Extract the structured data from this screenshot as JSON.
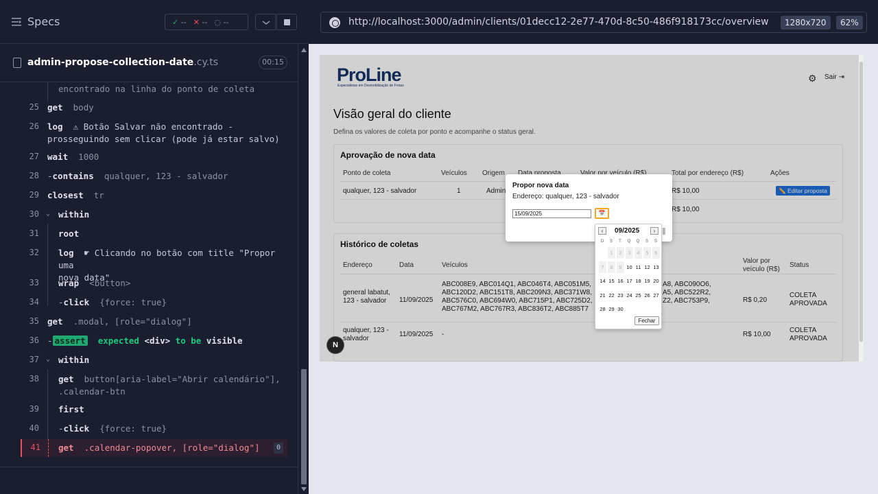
{
  "runner": {
    "title": "Specs",
    "stats": {
      "passed": "--",
      "failed": "--",
      "pending": "--"
    },
    "spec_name": "admin-propose-collection-date",
    "spec_ext": ".cy.ts",
    "duration": "00:15",
    "icons": {
      "specs": "specs-list-icon",
      "file": "document-icon",
      "chevron": "chevron-down-icon",
      "stop": "stop-icon"
    },
    "commands": [
      {
        "num": "",
        "name": "",
        "arg": "encontrado na linha do ponto de coleta"
      },
      {
        "num": "25",
        "name": "get",
        "arg": "body"
      },
      {
        "num": "26",
        "name": "log",
        "arg": "⚠ Botão Salvar não encontrado -",
        "arg2": "prosseguindo sem clicar (pode já estar salvo)"
      },
      {
        "num": "27",
        "name": "wait",
        "arg": "1000"
      },
      {
        "num": "28",
        "name": "contains",
        "arg": "qualquer, 123 - salvador"
      },
      {
        "num": "29",
        "name": "closest",
        "arg": "tr"
      },
      {
        "num": "30",
        "name": "within",
        "arg": ""
      },
      {
        "num": "31",
        "name": "root",
        "arg": ""
      },
      {
        "num": "32",
        "name": "log",
        "arg": "☛ Clicando no botão com title \"Propor uma",
        "arg2": "nova data\""
      },
      {
        "num": "33",
        "name": "wrap",
        "arg": "<button>"
      },
      {
        "num": "34",
        "name": "click",
        "arg": "{force: true}"
      },
      {
        "num": "35",
        "name": "get",
        "arg": ".modal, [role=\"dialog\"]"
      },
      {
        "num": "36",
        "name": "assert",
        "arg": "expected <div> to be visible",
        "a1": "expected",
        "a2": "<div>",
        "a3": "to be",
        "a4": "visible"
      },
      {
        "num": "37",
        "name": "within",
        "arg": ""
      },
      {
        "num": "38",
        "name": "get",
        "arg": "button[aria-label=\"Abrir calendário\"],",
        "arg2": ".calendar-btn"
      },
      {
        "num": "39",
        "name": "first",
        "arg": ""
      },
      {
        "num": "40",
        "name": "click",
        "arg": "{force: true}"
      },
      {
        "num": "41",
        "name": "get",
        "arg": ".calendar-popover, [role=\"dialog\"]",
        "count": "0"
      }
    ]
  },
  "browser": {
    "url": "http://localhost:3000/admin/clients/01decc12-2e77-470d-8c50-486f918173cc/overview",
    "viewport": "1280x720",
    "zoom": "62%"
  },
  "app": {
    "logo": "ProLine",
    "logo_tagline": "Especialistas em Desmobilização de Frotas",
    "logout": "Sair",
    "page_title": "Visão geral do cliente",
    "page_subtitle": "Defina os valores de coleta por ponto e acompanhe o status geral.",
    "approval": {
      "title": "Aprovação de nova data",
      "headers": [
        "Ponto de coleta",
        "Veículos",
        "Origem",
        "Data proposta",
        "Valor por veículo (R$)",
        "Total por endereço (R$)",
        "Ações"
      ],
      "row": {
        "ponto": "qualquer, 123 - salvador",
        "veiculos": "1",
        "origem": "Admin",
        "total": "R$ 10,00",
        "action": "✏️ Editar proposta"
      },
      "footer_total": "R$ 10,00"
    },
    "history": {
      "title": "Histórico de coletas",
      "headers": [
        "Endereço",
        "Data",
        "Veículos",
        "Valor por veículo (R$)",
        "Status"
      ],
      "rows": [
        {
          "endereco": "general labatut, 123 - salvador",
          "data": "11/09/2025",
          "veiculos": "ABC008E9, ABC014Q1, ABC046T4, ABC051M5, ABC120D2, ABC151T8, ABC209N3, ABC371W8, ABC576C0, ABC694W0, ABC715P1, ABC725D2, ABC767M2, ABC767R3, ABC836T2, ABC885T7",
          "veiculos_right1": "A8, ABC090O6,",
          "veiculos_right2": "A5, ABC522R2,",
          "veiculos_right3": "Z2, ABC753P9,",
          "valor": "R$ 0,20",
          "status": "COLETA APROVADA"
        },
        {
          "endereco": "qualquer, 123 - salvador",
          "data": "11/09/2025",
          "veiculos": "-",
          "valor": "R$ 10,00",
          "status": "COLETA APROVADA"
        }
      ]
    },
    "modal": {
      "title": "Propor nova data",
      "address": "Endereço: qualquer, 123 - salvador",
      "date_value": "15/09/2025"
    },
    "calendar": {
      "month": "09/2025",
      "weekdays": [
        "D",
        "S",
        "T",
        "Q",
        "Q",
        "S",
        "S"
      ],
      "weeks": [
        [
          {
            "d": "",
            "dis": true
          },
          {
            "d": "1",
            "dis": true
          },
          {
            "d": "2",
            "dis": true
          },
          {
            "d": "3",
            "dis": true
          },
          {
            "d": "4",
            "dis": true
          },
          {
            "d": "5",
            "dis": true
          },
          {
            "d": "6",
            "dis": true
          }
        ],
        [
          {
            "d": "7",
            "dis": true
          },
          {
            "d": "8",
            "dis": true
          },
          {
            "d": "9",
            "dis": true
          },
          {
            "d": "10"
          },
          {
            "d": "11"
          },
          {
            "d": "12"
          },
          {
            "d": "13"
          }
        ],
        [
          {
            "d": "14"
          },
          {
            "d": "15"
          },
          {
            "d": "16"
          },
          {
            "d": "17"
          },
          {
            "d": "18"
          },
          {
            "d": "19"
          },
          {
            "d": "20"
          }
        ],
        [
          {
            "d": "21"
          },
          {
            "d": "22"
          },
          {
            "d": "23"
          },
          {
            "d": "24"
          },
          {
            "d": "25"
          },
          {
            "d": "26"
          },
          {
            "d": "27"
          }
        ],
        [
          {
            "d": "28"
          },
          {
            "d": "29"
          },
          {
            "d": "30"
          }
        ]
      ],
      "close": "Fechar",
      "prev": "‹",
      "next": "›"
    },
    "next_badge": "N"
  }
}
